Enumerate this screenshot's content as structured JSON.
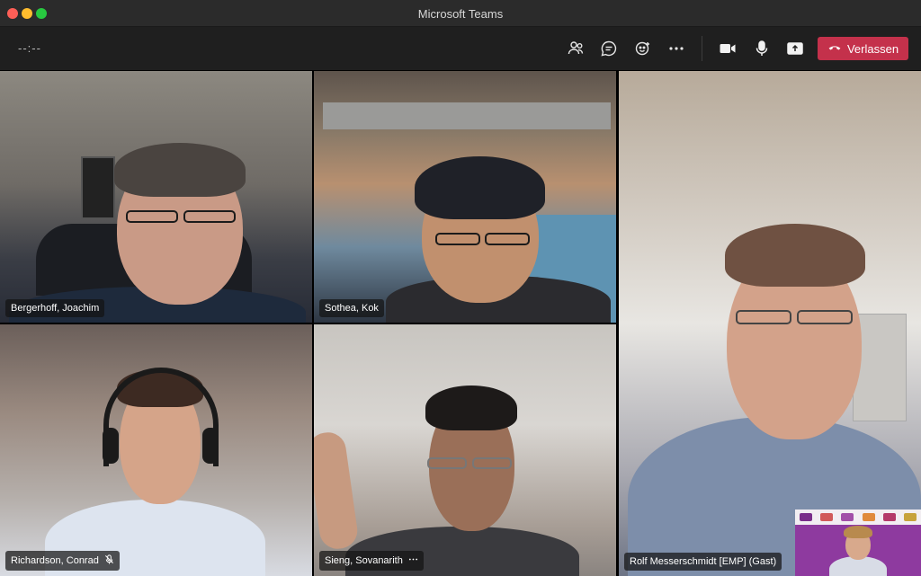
{
  "window": {
    "title": "Microsoft Teams"
  },
  "toolbar": {
    "timer": "--:--",
    "icons": [
      "participants-icon",
      "chat-icon",
      "reactions-icon",
      "more-icon",
      "camera-icon",
      "microphone-icon",
      "share-icon"
    ],
    "leave_label": "Verlassen"
  },
  "participants": [
    {
      "name": "Bergerhoff, Joachim"
    },
    {
      "name": "Sothea, Kok"
    },
    {
      "name": "Rolf Messerschmidt [EMP] (Gast)"
    },
    {
      "name": "Richardson, Conrad"
    },
    {
      "name": "Sieng, Sovanarith"
    }
  ],
  "colors": {
    "leave": "#c4314b",
    "titlebar": "#2b2b2b",
    "toolbar": "#1f1f1f"
  }
}
